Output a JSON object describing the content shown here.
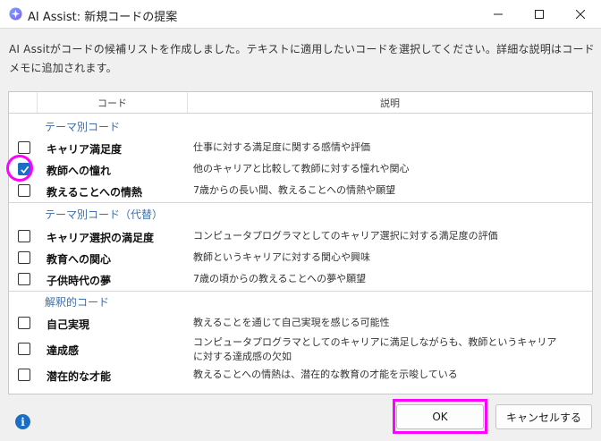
{
  "window": {
    "title": "AI Assist: 新規コードの提案"
  },
  "description": "AI Assitがコードの候補リストを作成しました。テキストに適用したいコードを選択してください。詳細な説明はコードメモに追加されます。",
  "table": {
    "columns": [
      "コード",
      "説明"
    ],
    "groups": [
      {
        "title": "テーマ別コード",
        "rows": [
          {
            "code": "キャリア満足度",
            "explanation": "仕事に対する満足度に関する感情や評価",
            "checked": false
          },
          {
            "code": "教師への憧れ",
            "explanation": "他のキャリアと比較して教師に対する憧れや関心",
            "checked": true
          },
          {
            "code": "教えることへの情熱",
            "explanation": "7歳からの長い間、教えることへの情熱や願望",
            "checked": false
          }
        ]
      },
      {
        "title": "テーマ別コード（代替）",
        "rows": [
          {
            "code": "キャリア選択の満足度",
            "explanation": "コンピュータプログラマとしてのキャリア選択に対する満足度の評価",
            "checked": false
          },
          {
            "code": "教育への関心",
            "explanation": "教師というキャリアに対する関心や興味",
            "checked": false
          },
          {
            "code": "子供時代の夢",
            "explanation": "7歳の頃からの教えることへの夢や願望",
            "checked": false
          }
        ]
      },
      {
        "title": "解釈的コード",
        "rows": [
          {
            "code": "自己実現",
            "explanation": "教えることを通じて自己実現を感じる可能性",
            "checked": false
          },
          {
            "code": "達成感",
            "explanation_line1": "コンピュータプログラマとしてのキャリアに満足しながらも、教師というキャリア",
            "explanation_line2": "に対する達成感の欠如",
            "checked": false
          },
          {
            "code": "潜在的な才能",
            "explanation": "教えることへの情熱は、潜在的な教育の才能を示唆している",
            "checked": false
          }
        ]
      }
    ]
  },
  "buttons": {
    "ok": "OK",
    "cancel": "キャンセルする"
  },
  "colors": {
    "accent": "#1a6fc5",
    "group_title": "#3d6fa8",
    "highlight": "#ff00ff"
  },
  "icons": [
    "app-sparkle-icon",
    "minimize-icon",
    "maximize-icon",
    "close-icon",
    "info-icon",
    "checkmark-icon"
  ]
}
